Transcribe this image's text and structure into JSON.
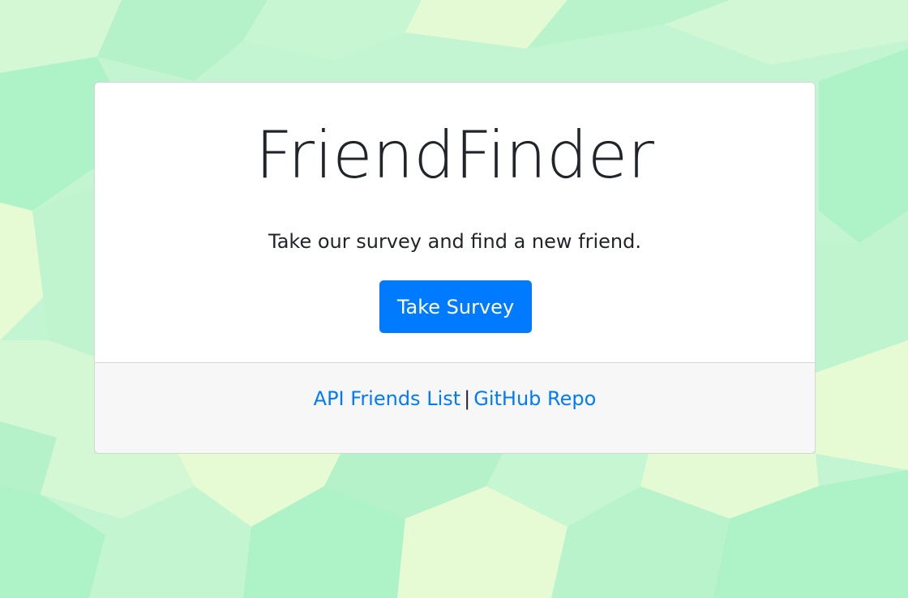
{
  "colors": {
    "accent": "#007bff",
    "background": "#c3f5d1",
    "text": "#212529"
  },
  "hero": {
    "title": "FriendFinder",
    "subtitle": "Take our survey and find a new friend.",
    "button_label": "Take Survey"
  },
  "footer": {
    "link_api": "API Friends List",
    "separator": "|",
    "link_github": "GitHub Repo"
  }
}
